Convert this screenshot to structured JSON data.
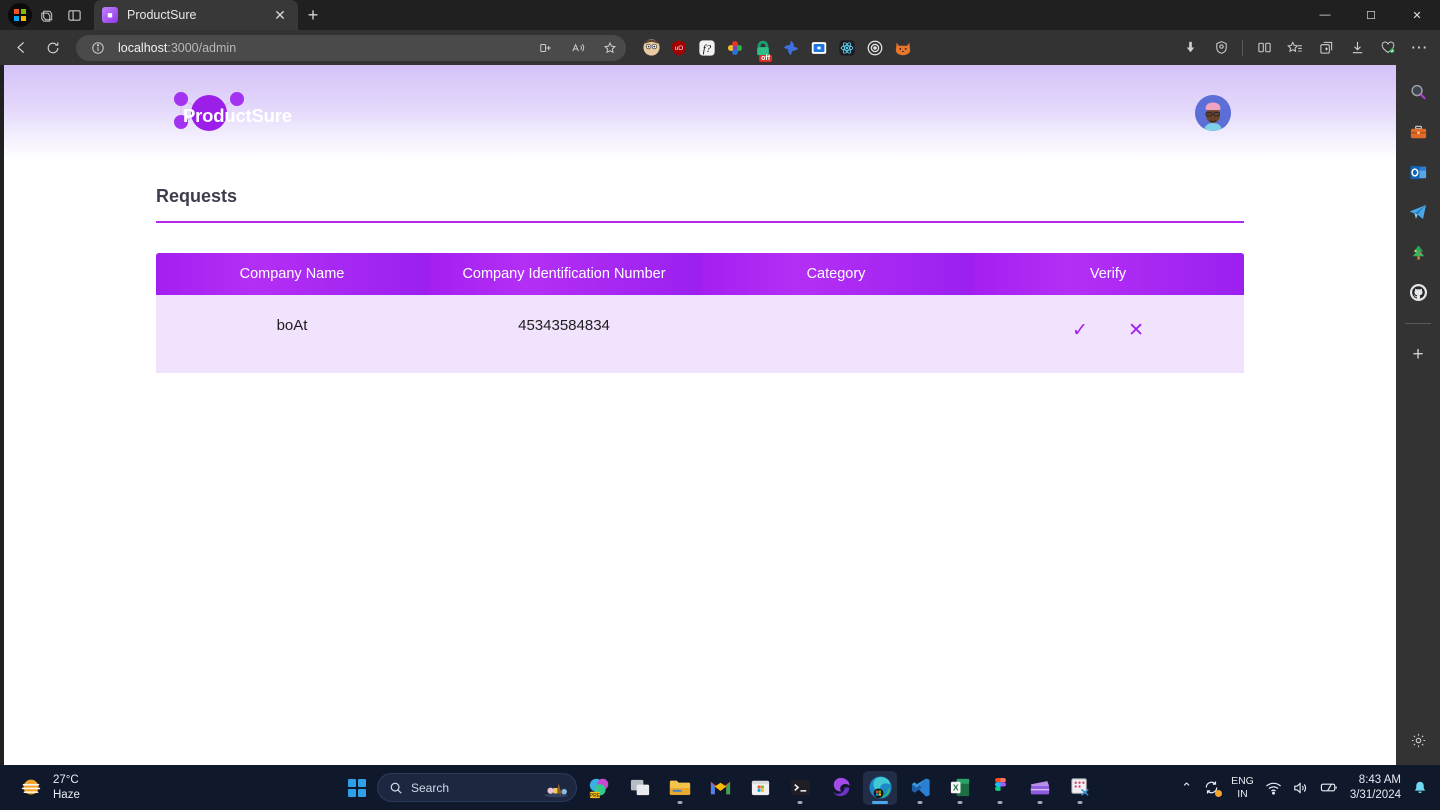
{
  "browser": {
    "tab": {
      "title": "ProductSure",
      "favicon": "productsure-favicon",
      "close_label": "✕"
    },
    "new_tab_label": "+",
    "window_controls": {
      "minimize": "—",
      "maximize": "☐",
      "close": "✕"
    },
    "address": {
      "host": "localhost",
      "path": ":3000/admin",
      "security": "info-icon"
    },
    "left_chrome_icons": [
      "copilot-icon",
      "workspaces-icon",
      "tab-actions-icon"
    ],
    "nav_icons": [
      "back-icon",
      "refresh-icon"
    ],
    "omnibox_icons": [
      "split-screen-icon",
      "read-aloud-icon",
      "favorite-star-icon"
    ],
    "extensions": [
      "profile-face-icon",
      "ublock-origin-icon",
      "font-finder-icon",
      "color-picker-icon",
      "vpn-off-icon",
      "spiral-icon",
      "screen-capture-icon",
      "react-devtools-icon",
      "target-icon",
      "fox-icon"
    ],
    "extension_badge": "off",
    "right_icons": [
      "downloads-arrow-icon",
      "shield-icon",
      "split-pane-icon",
      "favorites-icon",
      "collections-icon",
      "download-tray-icon",
      "browser-essentials-icon",
      "settings-ellipsis-icon"
    ]
  },
  "sidebar": {
    "items": [
      {
        "name": "search-icon",
        "glyph": "🔍"
      },
      {
        "name": "tools-briefcase-icon",
        "glyph": "🧰"
      },
      {
        "name": "outlook-icon",
        "glyph": "O"
      },
      {
        "name": "telegram-icon",
        "glyph": "➤"
      },
      {
        "name": "dropbox-tree-icon",
        "glyph": "🎄"
      },
      {
        "name": "github-icon",
        "glyph": ""
      }
    ],
    "add_label": "+",
    "settings_label": "settings-gear-icon"
  },
  "app": {
    "brand": {
      "name": "ProductSure",
      "accent": "#9b1fe8",
      "node_color": "#a333f0"
    },
    "avatar": {
      "name": "user-avatar"
    },
    "page_title": "Requests",
    "accent_color": "#b228f0",
    "table": {
      "columns": [
        "Company Name",
        "Company Identification Number",
        "Category",
        "Verify"
      ],
      "rows": [
        {
          "company_name": "boAt",
          "company_identification_number": "45343584834",
          "category": "",
          "approve_label": "✓",
          "reject_label": "✕"
        }
      ]
    }
  },
  "taskbar": {
    "weather": {
      "temperature": "27°C",
      "condition": "Haze",
      "icon": "haze-sun-icon"
    },
    "start_label": "start-icon",
    "search": {
      "placeholder": "Search",
      "icon": "search-icon"
    },
    "apps": [
      {
        "name": "copilot-pre-icon",
        "active": false,
        "running": false
      },
      {
        "name": "task-view-icon",
        "active": false,
        "running": false
      },
      {
        "name": "file-explorer-icon",
        "active": false,
        "running": true
      },
      {
        "name": "gmail-icon",
        "active": false,
        "running": false
      },
      {
        "name": "microsoft-store-icon",
        "active": false,
        "running": false
      },
      {
        "name": "terminal-icon",
        "active": false,
        "running": true
      },
      {
        "name": "edge-dev-icon",
        "active": false,
        "running": false
      },
      {
        "name": "microsoft-edge-icon",
        "active": true,
        "running": true
      },
      {
        "name": "vscode-icon",
        "active": false,
        "running": true
      },
      {
        "name": "excel-icon",
        "active": false,
        "running": true
      },
      {
        "name": "figma-icon",
        "active": false,
        "running": true
      },
      {
        "name": "video-editor-icon",
        "active": false,
        "running": true
      },
      {
        "name": "snipping-tool-icon",
        "active": false,
        "running": true
      }
    ],
    "tray": {
      "overflow": "⌃",
      "update_icon": "windows-update-icon",
      "language": {
        "line1": "ENG",
        "line2": "IN"
      },
      "network_icon": "wifi-icon",
      "volume_icon": "speaker-icon",
      "battery_icon": "battery-icon",
      "time": "8:43 AM",
      "date": "3/31/2024",
      "notifications_icon": "bell-icon"
    }
  }
}
